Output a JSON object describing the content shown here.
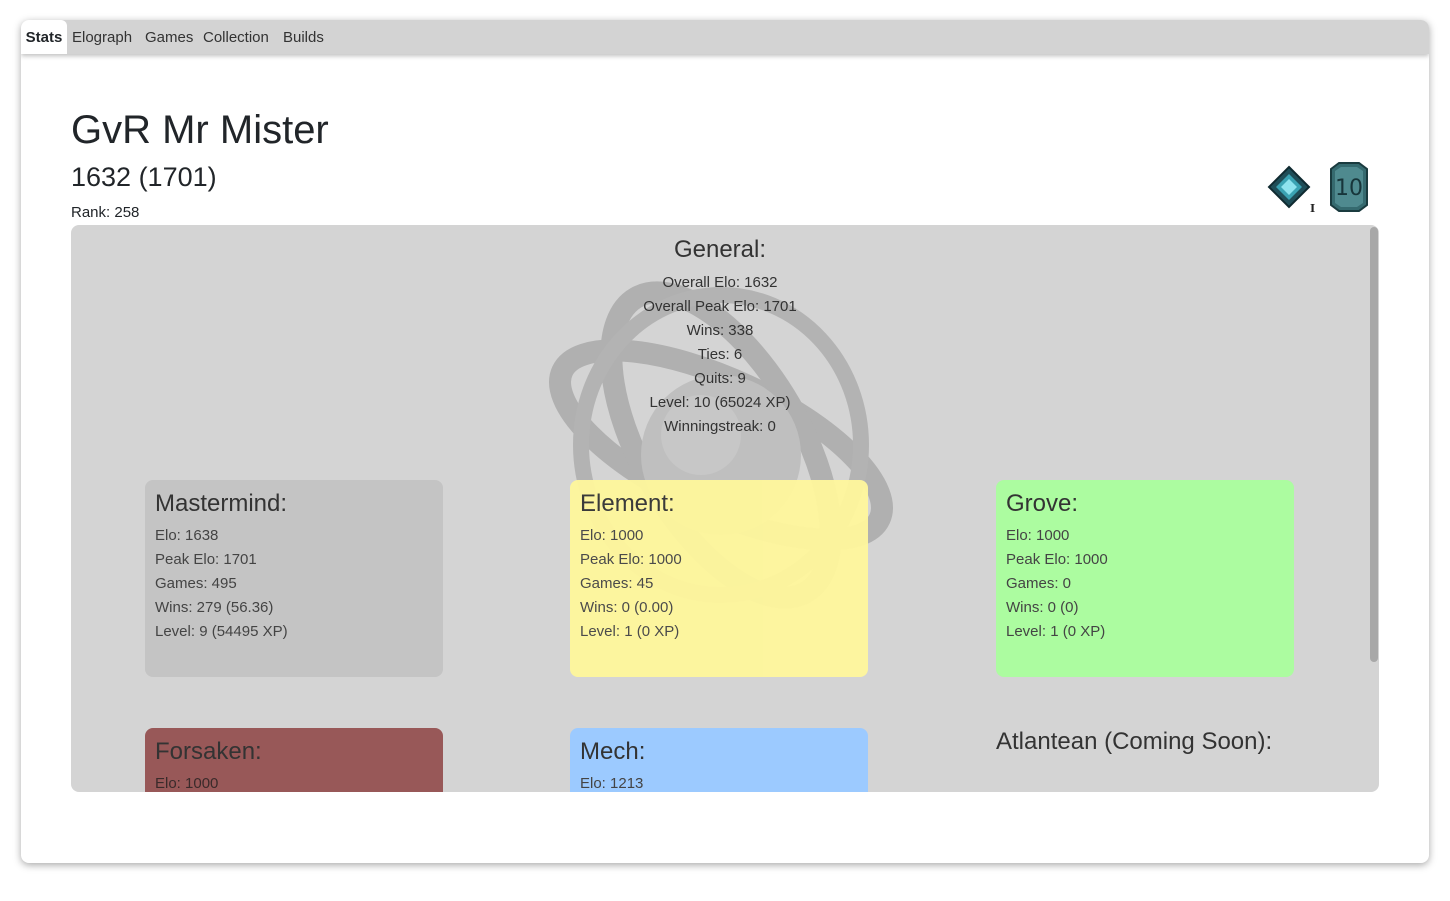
{
  "tabs": [
    {
      "label": "Stats",
      "active": true
    },
    {
      "label": "Elograph",
      "active": false
    },
    {
      "label": "Games",
      "active": false
    },
    {
      "label": "Collection",
      "active": false
    },
    {
      "label": "Builds",
      "active": false
    }
  ],
  "player": {
    "name": "GvR Mr Mister",
    "elo_line": "1632 (1701)",
    "rank": "Rank: 258",
    "rank_badge_numeral": "I",
    "level_badge": "10"
  },
  "general": {
    "title": "General:",
    "lines": [
      "Overall Elo: 1632",
      "Overall Peak Elo: 1701",
      "Wins: 338",
      "Ties: 6",
      "Quits: 9",
      "Level: 10 (65024 XP)",
      "Winningstreak: 0"
    ]
  },
  "races": [
    {
      "name": "Mastermind:",
      "color": "#c4c4c4",
      "lines": [
        "Elo: 1638",
        "Peak Elo: 1701",
        "Games: 495",
        "Wins: 279 (56.36)",
        "Level: 9 (54495 XP)"
      ]
    },
    {
      "name": "Element:",
      "color": "#fff79c",
      "lines": [
        "Elo: 1000",
        "Peak Elo: 1000",
        "Games: 45",
        "Wins: 0 (0.00)",
        "Level: 1 (0 XP)"
      ]
    },
    {
      "name": "Grove:",
      "color": "#acfca0",
      "lines": [
        "Elo: 1000",
        "Peak Elo: 1000",
        "Games: 0",
        "Wins: 0 (0)",
        "Level: 1 (0 XP)"
      ]
    },
    {
      "name": "Forsaken:",
      "color": "#985858",
      "lines": [
        "Elo: 1000"
      ]
    },
    {
      "name": "Mech:",
      "color": "#9ccaff",
      "lines": [
        "Elo: 1213"
      ]
    }
  ],
  "coming_soon": "Atlantean (Coming Soon):"
}
